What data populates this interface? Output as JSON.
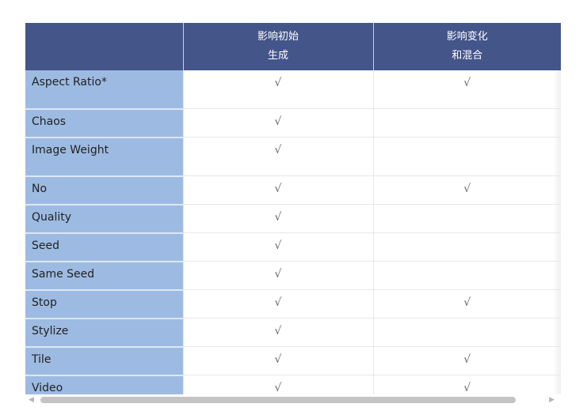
{
  "table": {
    "headers": [
      {
        "lines": [
          "",
          ""
        ]
      },
      {
        "lines": [
          "影响初始",
          "生成"
        ]
      },
      {
        "lines": [
          "影响变化",
          "和混合"
        ]
      }
    ],
    "check_glyph": "√",
    "rows": [
      {
        "name": "Aspect Ratio*",
        "initial": true,
        "variation": true,
        "tall": true
      },
      {
        "name": "Chaos",
        "initial": true,
        "variation": false,
        "tall": false
      },
      {
        "name": "Image Weight",
        "initial": true,
        "variation": false,
        "tall": true
      },
      {
        "name": "No",
        "initial": true,
        "variation": true,
        "tall": false
      },
      {
        "name": "Quality",
        "initial": true,
        "variation": false,
        "tall": false
      },
      {
        "name": "Seed",
        "initial": true,
        "variation": false,
        "tall": false
      },
      {
        "name": "Same Seed",
        "initial": true,
        "variation": false,
        "tall": false
      },
      {
        "name": "Stop",
        "initial": true,
        "variation": true,
        "tall": false
      },
      {
        "name": "Stylize",
        "initial": true,
        "variation": false,
        "tall": false
      },
      {
        "name": "Tile",
        "initial": true,
        "variation": true,
        "tall": false
      },
      {
        "name": "Video",
        "initial": true,
        "variation": true,
        "tall": false
      }
    ]
  },
  "colors": {
    "header_bg": "#44558a",
    "name_col_bg": "#9dbbe2"
  },
  "scrollbar": {
    "left_arrow": "◀",
    "right_arrow": "▶"
  }
}
